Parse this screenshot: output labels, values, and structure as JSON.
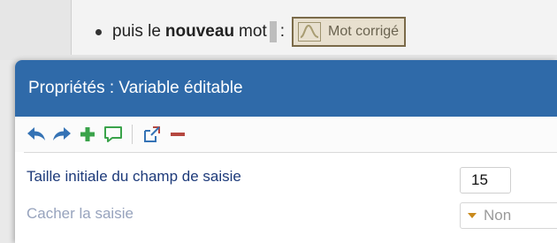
{
  "document": {
    "text_before": "puis le",
    "bold_word": "nouveau",
    "text_after": "mot",
    "colon": ":",
    "chip_label": "Mot corrigé"
  },
  "dialog": {
    "title": "Propriétés : Variable éditable",
    "toolbar": [
      "undo-icon",
      "redo-icon",
      "add-icon",
      "comment-icon",
      "open-external-icon",
      "remove-icon"
    ],
    "fields": {
      "size_label": "Taille initiale du champ de saisie",
      "size_value": "15",
      "hide_label": "Cacher la saisie",
      "hide_value": "Non"
    }
  },
  "colors": {
    "header": "#2f6aa9",
    "icon_blue": "#3573b5",
    "icon_green": "#3aa34a",
    "icon_red": "#b5473f"
  }
}
